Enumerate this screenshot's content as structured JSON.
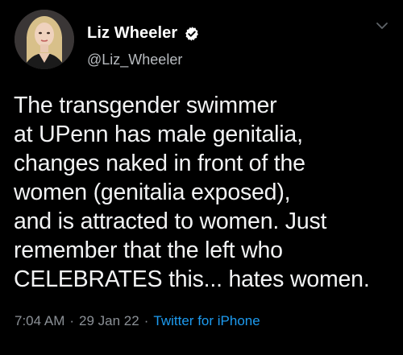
{
  "author": {
    "display_name": "Liz Wheeler",
    "handle": "@Liz_Wheeler",
    "verified_icon": "verified-badge-icon",
    "avatar_icon": "profile-avatar"
  },
  "tweet": {
    "lines": [
      "The transgender swimmer",
      "at UPenn has male genitalia,",
      "changes naked in front of the",
      "women (genitalia exposed),",
      "and is attracted to women. Just",
      "remember that the left who",
      "CELEBRATES this... hates women."
    ]
  },
  "meta": {
    "time": "7:04 AM",
    "separator": "·",
    "date": "29 Jan 22",
    "source": "Twitter for iPhone"
  },
  "colors": {
    "background": "#000000",
    "text": "#f2f3f4",
    "muted": "#8b9096",
    "link": "#1d9bf0"
  }
}
